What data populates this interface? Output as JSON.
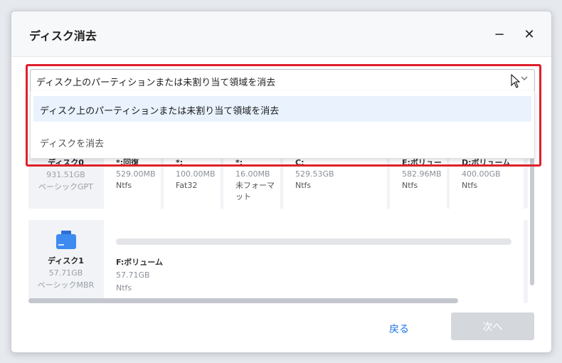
{
  "dialog": {
    "title": "ディスク消去",
    "minimize_glyph": "−",
    "close_glyph": "✕"
  },
  "dropdown": {
    "selected": "ディスク上のパーティションまたは未割り当て領域を消去",
    "options": [
      "ディスク上のパーティションまたは未割り当て領域を消去",
      "ディスクを消去"
    ]
  },
  "disk0": {
    "name": "ディスク0",
    "size": "931.51GB",
    "type": "ベーシックGPT",
    "partitions": [
      {
        "name": "*:回復",
        "size": "529.00MB",
        "fs": "Ntfs"
      },
      {
        "name": "*:",
        "size": "100.00MB",
        "fs": "Fat32"
      },
      {
        "name": "*:",
        "size": "16.00MB",
        "fs": "未フォーマット"
      },
      {
        "name": "C:",
        "size": "529.53GB",
        "fs": "Ntfs"
      },
      {
        "name": "E:ボリューム",
        "size": "582.96MB",
        "fs": "Ntfs"
      },
      {
        "name": "D:ボリューム",
        "size": "400.00GB",
        "fs": "Ntfs"
      }
    ]
  },
  "disk1": {
    "name": "ディスク1",
    "size": "57.71GB",
    "type": "ベーシックMBR",
    "partition": {
      "name": "F:ボリューム",
      "size": "57.71GB",
      "fs": "Ntfs"
    }
  },
  "footer": {
    "back_label": "戻る",
    "next_label": "次へ"
  },
  "colors": {
    "accent": "#1a73e8",
    "highlight_border": "#e0202a",
    "selected_bg": "#e9f2fd",
    "disabled_button": "#d4d7dc"
  },
  "icons": [
    "minimize-icon",
    "close-icon",
    "chevron-down-icon",
    "usb-disk-icon",
    "mouse-cursor-icon"
  ]
}
